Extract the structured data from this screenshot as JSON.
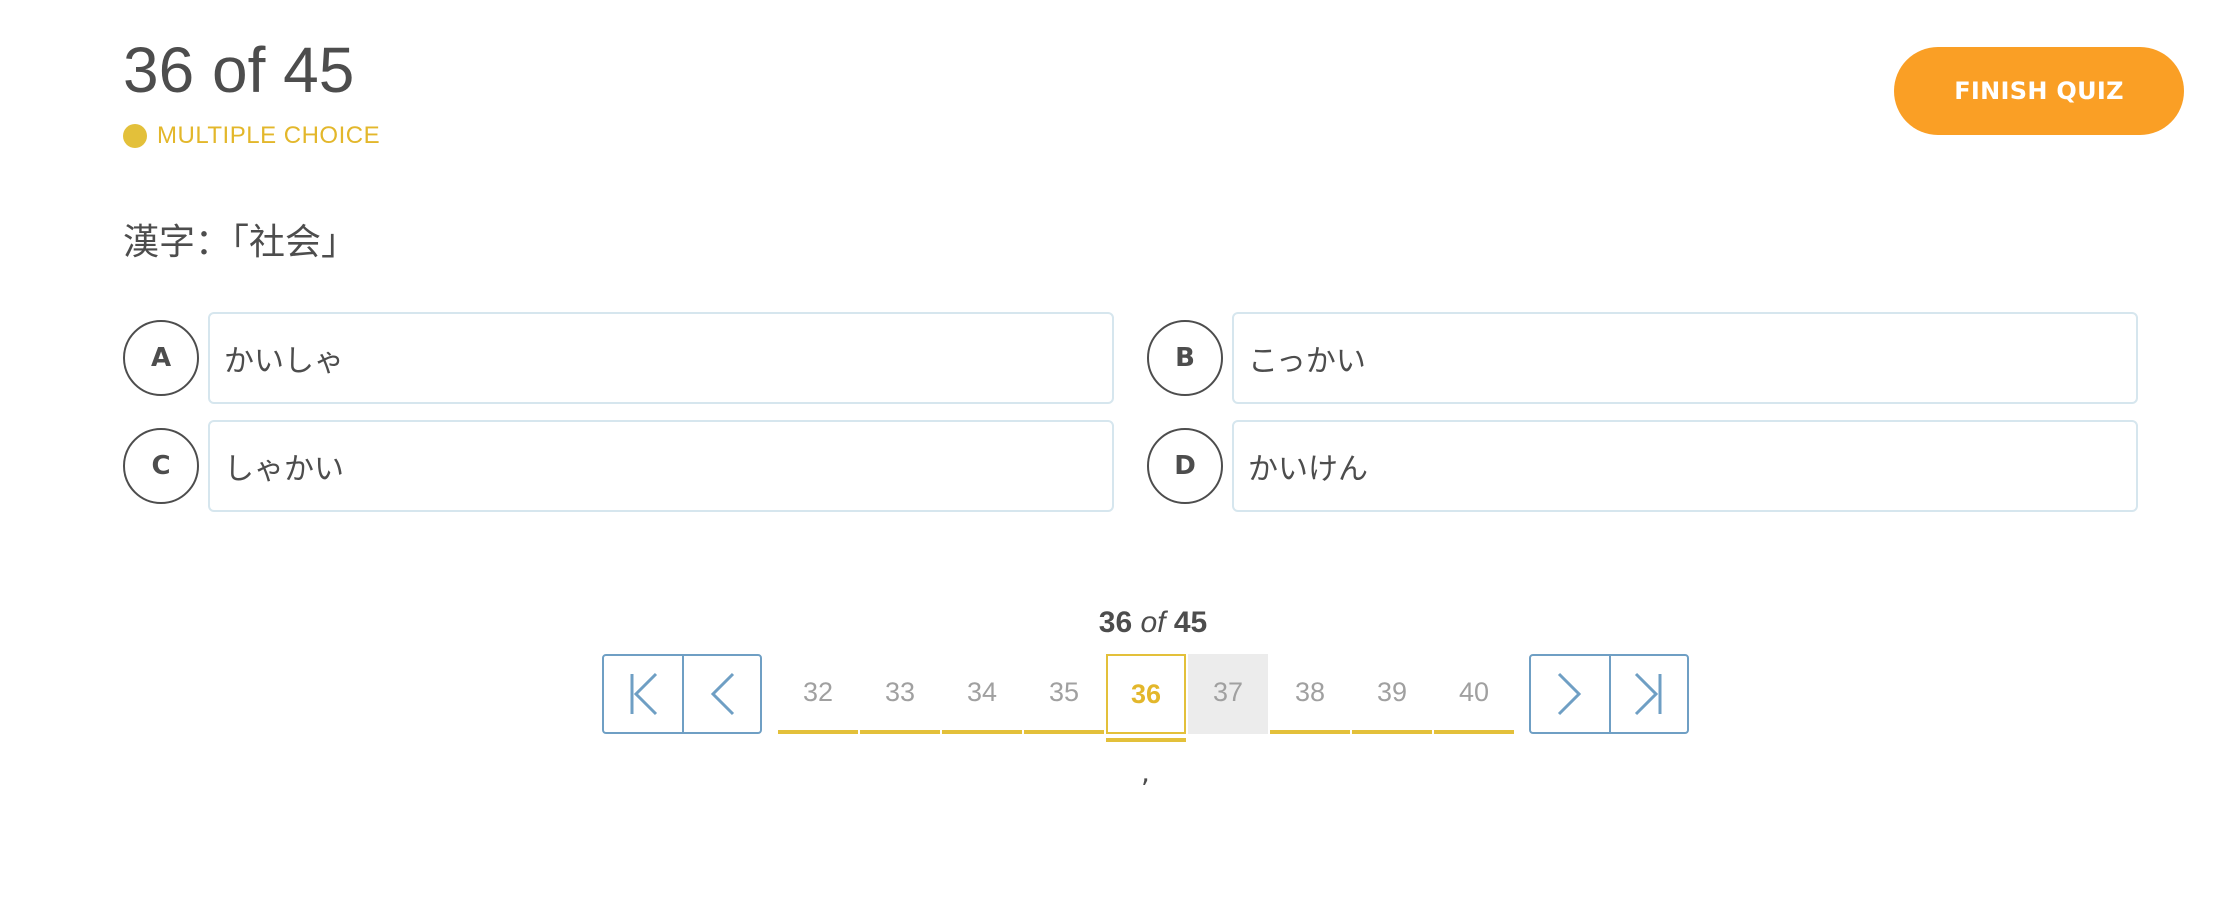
{
  "header": {
    "progress": "36 of 45",
    "question_type": "MULTIPLE CHOICE",
    "finish_label": "FINISH QUIZ"
  },
  "question": {
    "text": "漢字：「社会」"
  },
  "options": [
    {
      "letter": "A",
      "text": "かいしゃ"
    },
    {
      "letter": "B",
      "text": "こっかい"
    },
    {
      "letter": "C",
      "text": "しゃかい"
    },
    {
      "letter": "D",
      "text": "かいけん"
    }
  ],
  "pagination": {
    "current": "36",
    "of_word": "of",
    "total": "45",
    "pages": [
      "32",
      "33",
      "34",
      "35",
      "36",
      "37",
      "38",
      "39",
      "40"
    ],
    "mark": ","
  },
  "colors": {
    "accent_yellow": "#e3c03a",
    "finish_orange": "#fa9f25",
    "nav_blue": "#6f9fc4",
    "option_border": "#d6e6ee"
  },
  "icons": {
    "first": "first-page-icon",
    "prev": "chevron-left-icon",
    "next": "chevron-right-icon",
    "last": "last-page-icon"
  }
}
